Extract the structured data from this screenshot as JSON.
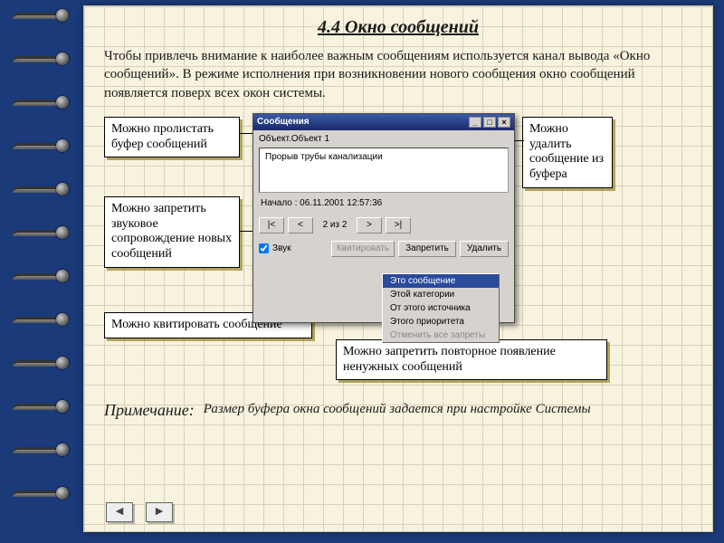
{
  "title": "4.4 Окно сообщений",
  "intro": "Чтобы привлечь внимание к наиболее важным сообщениям используется канал вывода «Окно сообщений». В режиме исполнения при возникновении нового сообщения окно сообщений появляется поверх всех окон системы.",
  "callouts": {
    "c1": "Можно пролистать буфер сообщений",
    "c2": "Можно запретить звуковое сопровождение новых сообщений",
    "c3": "Можно квитировать сообщение",
    "c4": "Можно удалить сообщение из буфера",
    "c5": "Можно запретить повторное появление ненужных сообщений"
  },
  "dialog": {
    "title": "Сообщения",
    "object": "Объект.Объект 1",
    "message": "Прорыв трубы канализации",
    "timestamp": "Начало : 06.11.2001 12:57:36",
    "counter": "2 из   2",
    "nav": {
      "first": "|<",
      "prev": "<",
      "next": ">",
      "last": ">|"
    },
    "sound_label": "Звук",
    "btn_kvit": "Квитировать",
    "btn_ban": "Запретить",
    "btn_del": "Удалить",
    "menu": {
      "m1": "Это сообщение",
      "m2": "Этой категории",
      "m3": "От этого источника",
      "m4": "Этого приоритета",
      "m5": "Отменить все запреты"
    }
  },
  "note": {
    "label": "Примечание:",
    "text": "Размер буфера окна сообщений задается при настройке Системы"
  },
  "footer": {
    "prev": "◄",
    "next": "►"
  }
}
